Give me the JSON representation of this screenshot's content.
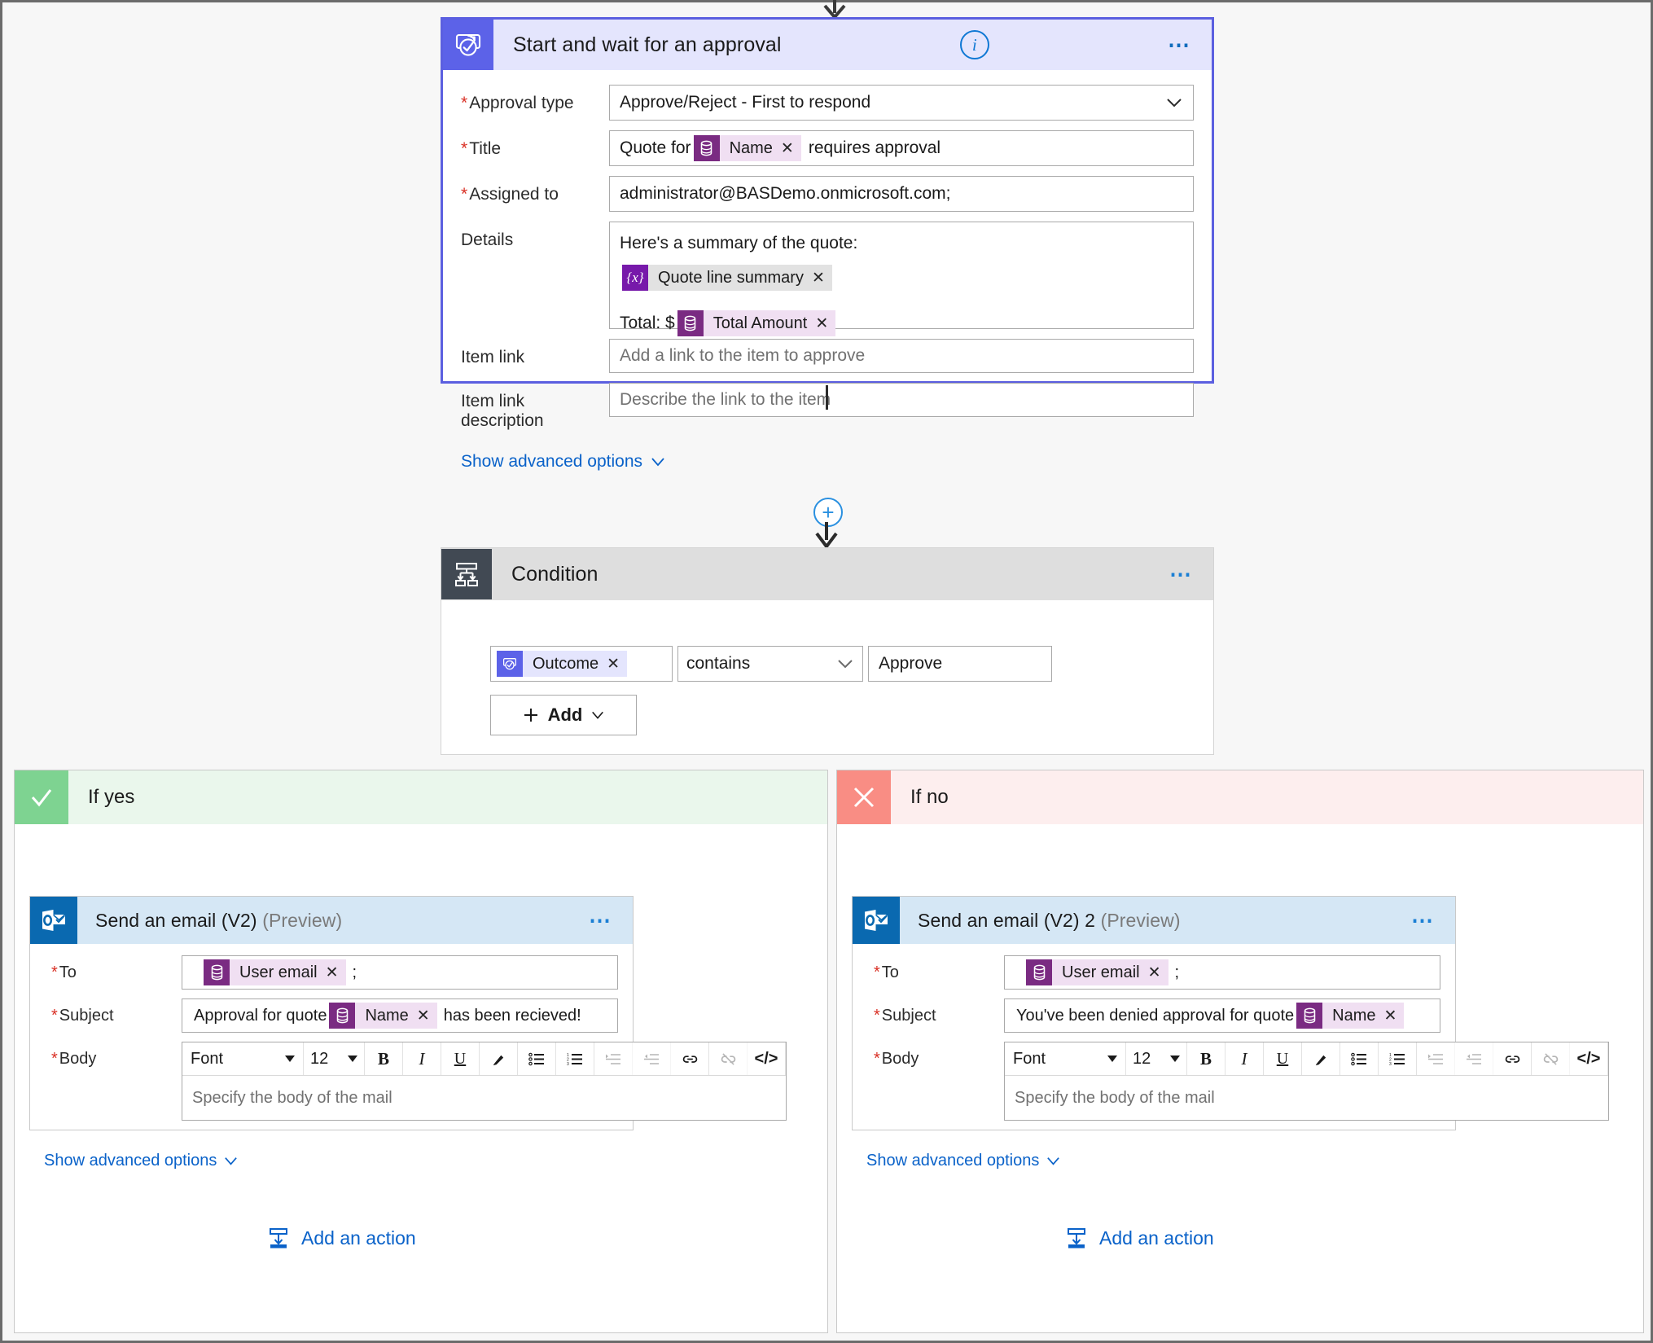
{
  "approval": {
    "icon": "approval-icon",
    "title": "Start and wait for an approval",
    "info_icon": "info-icon",
    "more_icon": "more-options-icon",
    "fields": {
      "approval_type": {
        "label": "Approval type",
        "required": true,
        "value": "Approve/Reject - First to respond"
      },
      "title": {
        "label": "Title",
        "required": true,
        "prefix": "Quote for",
        "token": "Name",
        "suffix": "requires approval"
      },
      "assigned_to": {
        "label": "Assigned to",
        "required": true,
        "value": "administrator@BASDemo.onmicrosoft.com;"
      },
      "details": {
        "label": "Details",
        "required": false,
        "line1": "Here's a summary of the quote:",
        "token1": "Quote line summary",
        "line3_prefix": "Total: $",
        "token2": "Total Amount"
      },
      "item_link": {
        "label": "Item link",
        "required": false,
        "placeholder": "Add a link to the item to approve"
      },
      "item_link_description": {
        "label": "Item link description",
        "required": false,
        "placeholder": "Describe the link to the item"
      }
    },
    "advanced_link": "Show advanced options"
  },
  "condition": {
    "icon": "condition-icon",
    "title": "Condition",
    "more_icon": "more-options-icon",
    "token": "Outcome",
    "operator": "contains",
    "value": "Approve",
    "add_button": "Add"
  },
  "branch_yes": {
    "icon": "checkmark-icon",
    "label": "If yes",
    "email": {
      "icon": "outlook-icon",
      "title": "Send an email (V2)",
      "title_suffix": "(Preview)",
      "more_icon": "more-options-icon",
      "to": {
        "label": "To",
        "required": true,
        "token": "User email",
        "trailing": ";"
      },
      "subject": {
        "label": "Subject",
        "required": true,
        "prefix": "Approval for quote",
        "token": "Name",
        "suffix": "has been recieved!"
      },
      "body": {
        "label": "Body",
        "required": true,
        "font_name": "Font",
        "font_size": "12",
        "placeholder": "Specify the body of the mail",
        "tools": [
          "bold-icon",
          "italic-icon",
          "underline-icon",
          "text-color-icon",
          "bullet-list-icon",
          "numbered-list-icon",
          "indent-icon",
          "outdent-icon",
          "link-icon",
          "unlink-icon",
          "code-view-icon"
        ]
      },
      "advanced_link": "Show advanced options"
    },
    "add_action": "Add an action",
    "add_action_icon": "add-action-icon"
  },
  "branch_no": {
    "icon": "cross-icon",
    "label": "If no",
    "email": {
      "icon": "outlook-icon",
      "title": "Send an email (V2) 2",
      "title_suffix": "(Preview)",
      "more_icon": "more-options-icon",
      "to": {
        "label": "To",
        "required": true,
        "token": "User email",
        "trailing": ";"
      },
      "subject": {
        "label": "Subject",
        "required": true,
        "prefix": "You've been denied approval for quote",
        "token": "Name",
        "suffix": ""
      },
      "body": {
        "label": "Body",
        "required": true,
        "font_name": "Font",
        "font_size": "12",
        "placeholder": "Specify the body of the mail",
        "tools": [
          "bold-icon",
          "italic-icon",
          "underline-icon",
          "text-color-icon",
          "bullet-list-icon",
          "numbered-list-icon",
          "indent-icon",
          "outdent-icon",
          "link-icon",
          "unlink-icon",
          "code-view-icon"
        ]
      },
      "advanced_link": "Show advanced options"
    },
    "add_action": "Add an action",
    "add_action_icon": "add-action-icon"
  },
  "colors": {
    "approval_accent": "#5c62e8",
    "approval_header_bg": "#e4e5fd",
    "condition_icon_bg": "#414953",
    "condition_header_bg": "#dedede",
    "yes_green": "#7ed391",
    "no_red": "#f98d84",
    "outlook_blue": "#0a69b0",
    "token_dataverse": "#7a2b82",
    "token_variable": "#7719aa",
    "link_blue": "#0a62c9",
    "required_red": "#d93025",
    "canvas_bg": "#f7f7f7"
  }
}
